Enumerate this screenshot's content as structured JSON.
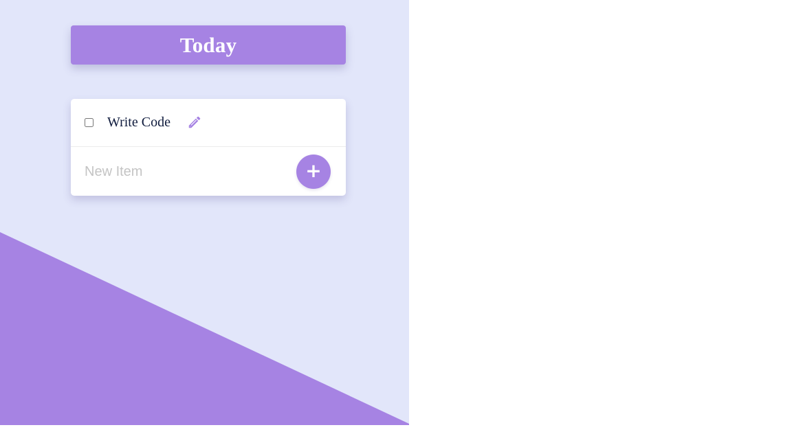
{
  "colors": {
    "accent": "#a683e3",
    "background": "#e2e6fa",
    "text": "#0f1b3d",
    "placeholder": "#c4c4c4"
  },
  "header": {
    "title": "Today"
  },
  "list": {
    "items": [
      {
        "label": "Write Code",
        "checked": false,
        "edit_icon": "pencil-icon"
      }
    ]
  },
  "new_item": {
    "placeholder": "New Item",
    "value": "",
    "add_label": "+"
  }
}
